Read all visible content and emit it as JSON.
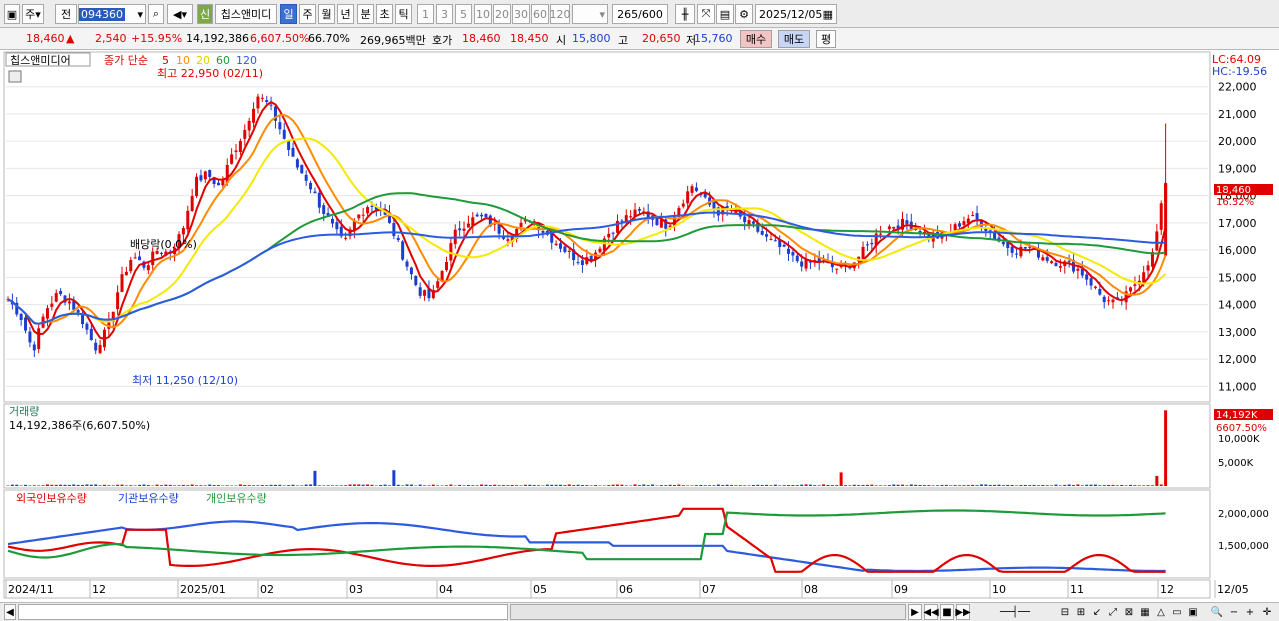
{
  "toolbar": {
    "market": "주",
    "prev": "전",
    "code": "094360",
    "credit_badge": "신",
    "name": "칩스앤미디",
    "periods": [
      "일",
      "주",
      "월",
      "년",
      "분",
      "초",
      "틱"
    ],
    "active_period": "일",
    "intervals": [
      "1",
      "3",
      "5",
      "10",
      "20",
      "30",
      "60",
      "120"
    ],
    "count": "265",
    "total": "/600",
    "date": "2025/12/05"
  },
  "quote": {
    "price": "18,460",
    "change_arrow": "▲",
    "change": "2,540",
    "change_pct": "+15.95%",
    "volume": "14,192,386",
    "volume_ratio": "6,607.50%",
    "turnover": "66.70%",
    "amount": "269,965백만",
    "hoga_label": "호가",
    "ask": "18,460",
    "bid": "18,450",
    "open_label": "시",
    "open": "15,800",
    "high_label": "고",
    "high": "20,650",
    "low_label": "저",
    "low": "15,760",
    "buy_label": "매수",
    "sell_label": "매도",
    "eval_label": "평"
  },
  "legend": {
    "stock_name": "칩스앤미디어",
    "ma_title": "종가 단순",
    "ma5": "5",
    "ma10": "10",
    "ma20": "20",
    "ma60": "60",
    "ma120": "120",
    "high_annot": "최고 22,950 (02/11)",
    "low_annot": "최저 11,250 (12/10)",
    "dividend": "배당락(0.0%)",
    "lc": "LC:64.09",
    "hc": "HC:-19.56",
    "last_price": "18,460",
    "last_pct": "16.32%",
    "price_ticks": [
      "22,000",
      "21,000",
      "20,000",
      "19,000",
      "18,000",
      "17,000",
      "16,000",
      "15,000",
      "14,000",
      "13,000",
      "12,000",
      "11,000"
    ]
  },
  "volume_panel": {
    "title": "거래량",
    "value": "14,192,386주(6,607.50%)",
    "last": "14,192K",
    "last_pct": "6607.50%",
    "ticks": [
      "10,000K",
      "5,000K"
    ]
  },
  "holdings_panel": {
    "foreign": "외국인보유수량",
    "inst": "기관보유수량",
    "indiv": "개인보유수량",
    "ticks": [
      "2,000,000",
      "1,500,000"
    ]
  },
  "x_axis": [
    "2024/11",
    "12",
    "2025/01",
    "02",
    "03",
    "04",
    "05",
    "06",
    "07",
    "08",
    "09",
    "10",
    "11",
    "12",
    "12/05"
  ],
  "colors": {
    "up": "#e00000",
    "down": "#1a3fd0",
    "ma5": "#e00000",
    "ma10": "#ff8c00",
    "ma20": "#f5e900",
    "ma60": "#1f9a3a",
    "ma120": "#2d5be0"
  },
  "chart_data": {
    "type": "line",
    "title": "",
    "xlabel": "",
    "ylabel": "",
    "ylim": [
      10500,
      23200
    ],
    "price_series_points": [
      [
        0,
        14200
      ],
      [
        10,
        13600
      ],
      [
        20,
        12300
      ],
      [
        30,
        13800
      ],
      [
        40,
        14400
      ],
      [
        50,
        14100
      ],
      [
        60,
        13400
      ],
      [
        70,
        12400
      ],
      [
        80,
        13100
      ],
      [
        90,
        14800
      ],
      [
        100,
        15800
      ],
      [
        110,
        15400
      ],
      [
        120,
        16000
      ],
      [
        130,
        15900
      ],
      [
        140,
        16700
      ],
      [
        150,
        18500
      ],
      [
        160,
        18800
      ],
      [
        170,
        18300
      ],
      [
        180,
        19500
      ],
      [
        190,
        20400
      ],
      [
        200,
        21700
      ],
      [
        210,
        21300
      ],
      [
        220,
        20300
      ],
      [
        230,
        19200
      ],
      [
        240,
        18600
      ],
      [
        250,
        17700
      ],
      [
        260,
        16900
      ],
      [
        270,
        16200
      ],
      [
        280,
        17200
      ],
      [
        290,
        17700
      ],
      [
        300,
        17500
      ],
      [
        310,
        16600
      ],
      [
        320,
        15500
      ],
      [
        330,
        14500
      ],
      [
        340,
        14200
      ],
      [
        350,
        15400
      ],
      [
        360,
        16700
      ],
      [
        370,
        17100
      ],
      [
        380,
        17200
      ],
      [
        390,
        16900
      ],
      [
        400,
        16500
      ],
      [
        410,
        16800
      ],
      [
        420,
        17200
      ],
      [
        430,
        16700
      ],
      [
        440,
        16300
      ],
      [
        450,
        15900
      ],
      [
        460,
        15600
      ],
      [
        470,
        15800
      ],
      [
        480,
        16500
      ],
      [
        490,
        17000
      ],
      [
        500,
        17300
      ],
      [
        510,
        17400
      ],
      [
        520,
        17100
      ],
      [
        530,
        16900
      ],
      [
        540,
        17700
      ],
      [
        550,
        18400
      ],
      [
        560,
        17800
      ],
      [
        570,
        17400
      ],
      [
        580,
        17500
      ],
      [
        590,
        17100
      ],
      [
        600,
        16800
      ],
      [
        610,
        16400
      ],
      [
        620,
        16100
      ],
      [
        630,
        15700
      ],
      [
        640,
        15500
      ],
      [
        650,
        15600
      ],
      [
        660,
        15400
      ],
      [
        670,
        15300
      ],
      [
        680,
        15600
      ],
      [
        690,
        16100
      ],
      [
        700,
        16700
      ],
      [
        710,
        16900
      ],
      [
        720,
        17000
      ],
      [
        730,
        16800
      ],
      [
        740,
        16500
      ],
      [
        750,
        16500
      ],
      [
        760,
        16800
      ],
      [
        770,
        17200
      ],
      [
        780,
        17100
      ],
      [
        790,
        16600
      ],
      [
        800,
        16200
      ],
      [
        810,
        16000
      ],
      [
        820,
        16100
      ],
      [
        830,
        15800
      ],
      [
        840,
        15600
      ],
      [
        850,
        15500
      ],
      [
        860,
        15300
      ],
      [
        870,
        14800
      ],
      [
        880,
        14200
      ],
      [
        890,
        14000
      ],
      [
        900,
        14400
      ],
      [
        910,
        15100
      ],
      [
        920,
        15900
      ],
      [
        930,
        18460
      ]
    ],
    "volume_spike_last": 14192386,
    "series": [
      {
        "name": "5",
        "role": "ma5"
      },
      {
        "name": "10",
        "role": "ma10"
      },
      {
        "name": "20",
        "role": "ma20"
      },
      {
        "name": "60",
        "role": "ma60"
      },
      {
        "name": "120",
        "role": "ma120"
      },
      {
        "name": "외국인보유수량",
        "role": "foreign"
      },
      {
        "name": "기관보유수량",
        "role": "inst"
      },
      {
        "name": "개인보유수량",
        "role": "indiv"
      }
    ]
  }
}
